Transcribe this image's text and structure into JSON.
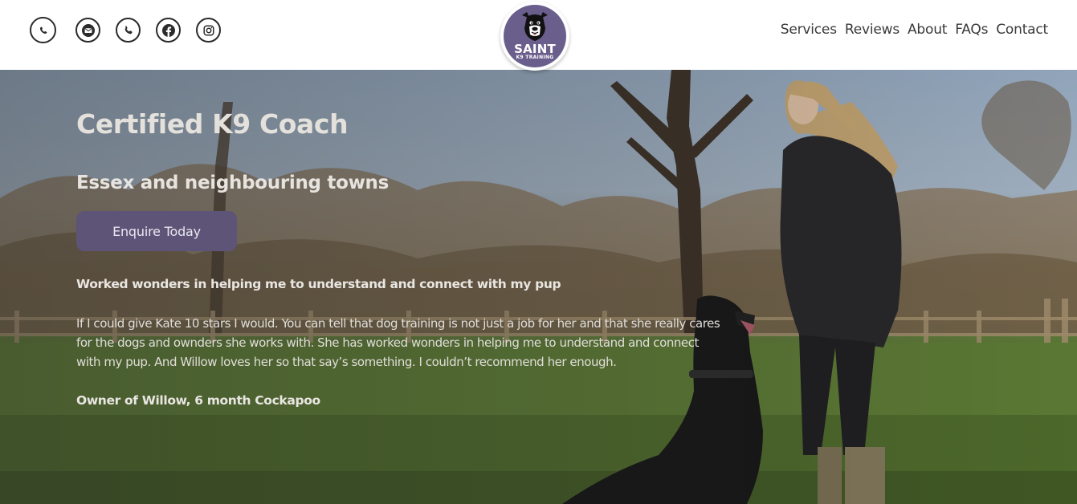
{
  "brand": {
    "logo_name": "SAINT",
    "logo_sub": "K9 TRAINING",
    "accent": "#6a5e8c",
    "button_color": "#5d5478"
  },
  "socials": [
    {
      "icon": "whatsapp-icon"
    },
    {
      "icon": "email-icon"
    },
    {
      "icon": "phone-icon"
    },
    {
      "icon": "facebook-icon"
    },
    {
      "icon": "instagram-icon"
    }
  ],
  "nav": {
    "items": [
      "Services",
      "Reviews",
      "About",
      "FAQs",
      "Contact"
    ]
  },
  "hero": {
    "title": "Certified K9 Coach",
    "subtitle": "Essex and neighbouring towns",
    "cta_label": "Enquire Today",
    "review": {
      "headline": "Worked wonders in helping me to understand and connect with my pup",
      "body_lines": [
        "If I could give Kate 10 stars I would. You can tell that dog training is not just a job for her and that she really cares",
        "for the dogs and ownders she works with. She has worked wonders in helping me to understand and connect",
        "with my pup. And Willow loves her so that say’s something. I couldn’t recommend her enough."
      ],
      "author": "Owner of Willow, 6 month Cockapoo"
    }
  }
}
